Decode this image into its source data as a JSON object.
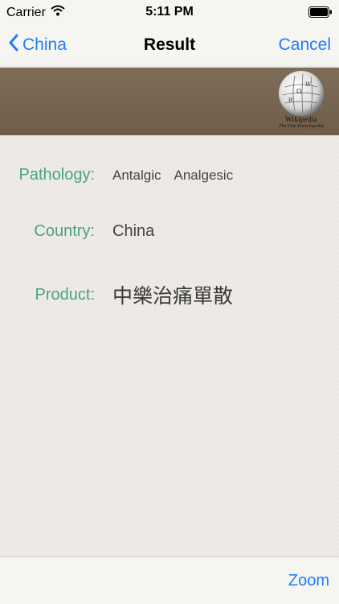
{
  "status_bar": {
    "carrier": "Carrier",
    "time": "5:11 PM"
  },
  "nav": {
    "back_label": "China",
    "title": "Result",
    "cancel_label": "Cancel"
  },
  "banner": {
    "logo_word": "Wikipedia",
    "logo_tagline": "The Free Encyclopedia"
  },
  "details": {
    "pathology_label": "Pathology:",
    "pathology_values": [
      "Antalgic",
      "Analgesic"
    ],
    "country_label": "Country:",
    "country_value": "China",
    "product_label": "Product:",
    "product_value": "中樂治痛單散"
  },
  "toolbar": {
    "zoom_label": "Zoom"
  },
  "colors": {
    "accent": "#1f7ef6",
    "label": "#4aa37e",
    "banner": "#7d6c58"
  }
}
